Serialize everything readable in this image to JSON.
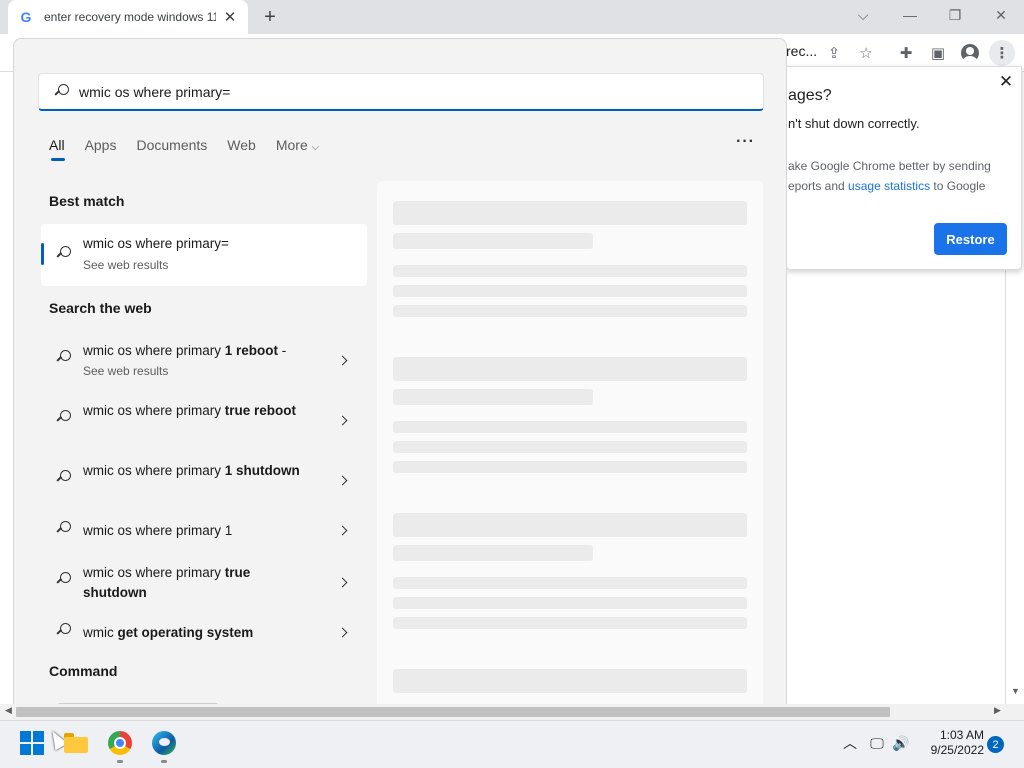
{
  "browser": {
    "tab_title": "enter recovery mode windows 11",
    "tab_favicon": "G",
    "new_tab_symbol": "+",
    "omnibox_tail": "rec...",
    "window_controls": {
      "collapse": "⌵",
      "minimize": "—",
      "restore": "❐",
      "close": "✕"
    }
  },
  "restore_popup": {
    "title": "ages?",
    "message": "n't shut down correctly.",
    "consent_pre": "ake Google Chrome better by sending",
    "consent_line2_pre": "eports and ",
    "consent_link": "usage statistics",
    "consent_post": " to Google",
    "button_label": "Restore",
    "close_symbol": "✕"
  },
  "search": {
    "query": "wmic os where primary=",
    "filters": [
      "All",
      "Apps",
      "Documents",
      "Web",
      "More"
    ],
    "active_filter": "All",
    "more_dots": "···",
    "best_match_heading": "Best match",
    "best_match": {
      "title": "wmic os where primary=",
      "subtitle": "See web results"
    },
    "web_heading": "Search the web",
    "web_results": [
      {
        "prefix": "wmic os where primary ",
        "bold": "1 reboot",
        "suffix": " -",
        "sub": "See web results"
      },
      {
        "prefix": "wmic os where primary ",
        "bold": "true reboot",
        "suffix": "",
        "sub": ""
      },
      {
        "prefix": "wmic os where primary ",
        "bold": "1 shutdown",
        "suffix": "",
        "sub": ""
      },
      {
        "prefix": "wmic os where primary 1",
        "bold": "",
        "suffix": "",
        "sub": ""
      },
      {
        "prefix": "wmic os where primary ",
        "bold": "true shutdown",
        "suffix": "",
        "sub": ""
      },
      {
        "prefix": "wmic ",
        "bold": "get operating system",
        "suffix": "",
        "sub": ""
      }
    ],
    "command_heading": "Command"
  },
  "taskbar": {
    "apps": [
      "start-button",
      "file-explorer",
      "google-chrome",
      "microsoft-edge"
    ],
    "time": "1:03 AM",
    "date": "9/25/2022",
    "notification_count": "2"
  },
  "colors": {
    "accent": "#005fb8",
    "chrome_blue": "#1a73e8",
    "panel_bg": "#f3f3f3"
  }
}
